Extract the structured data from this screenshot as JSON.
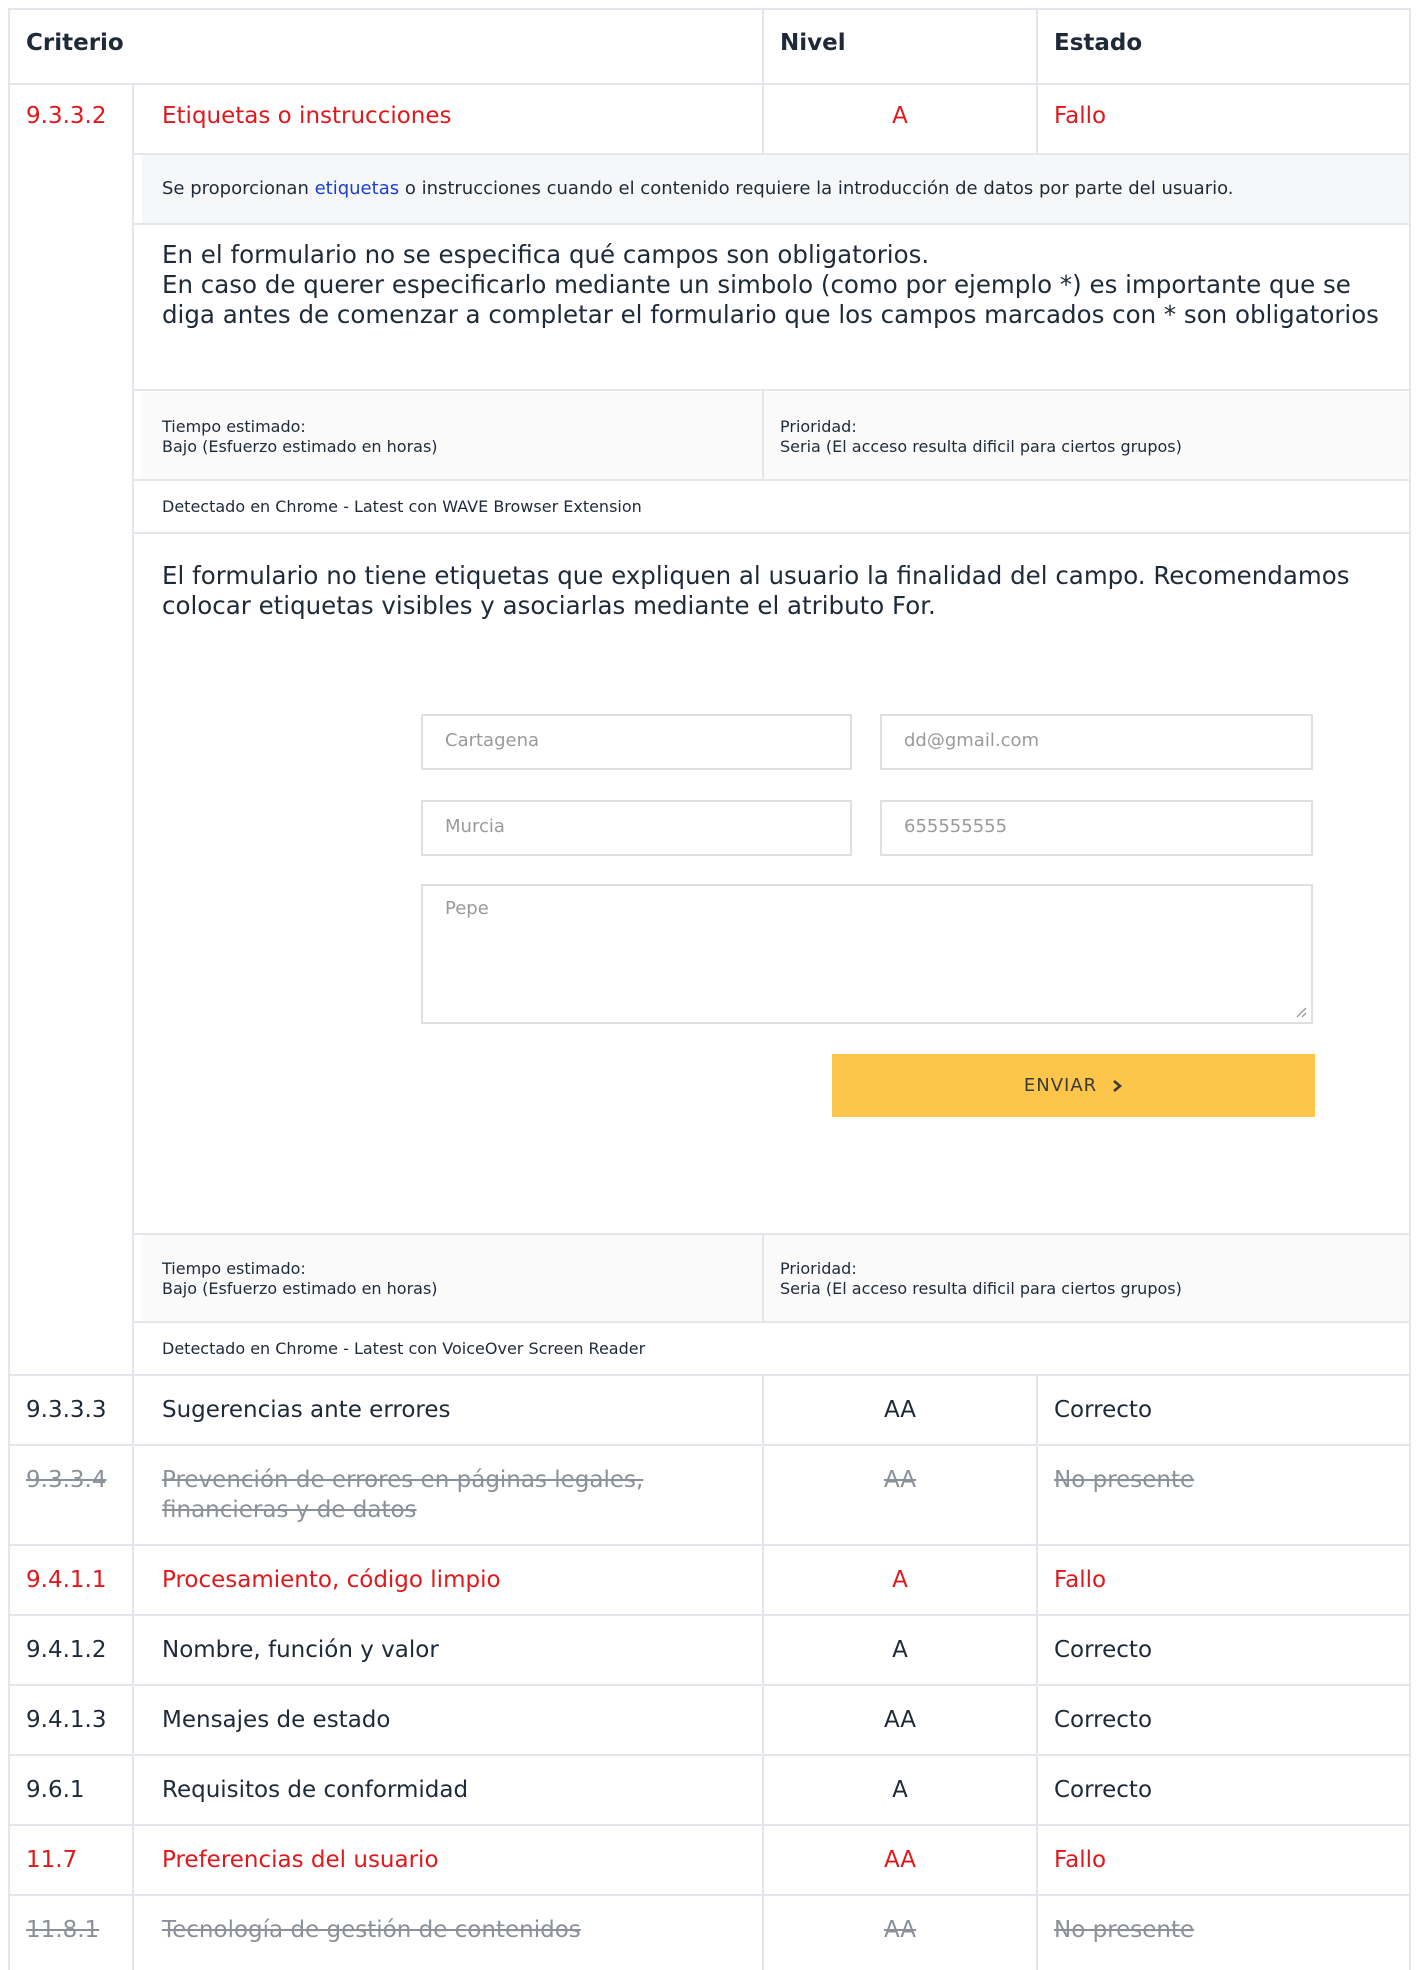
{
  "table": {
    "headers": {
      "criterio": "Criterio",
      "nivel": "Nivel",
      "estado": "Estado"
    },
    "expanded_row": {
      "code": "9.3.3.2",
      "name": "Etiquetas o instrucciones",
      "level": "A",
      "status": "Fallo",
      "description_pre": "Se proporcionan ",
      "description_link": "etiquetas",
      "description_post": " o instrucciones cuando el contenido requiere la introducción de datos por parte del usuario.",
      "issues": [
        {
          "text": "En el formulario no se especifica qué campos son obligatorios.\nEn caso de querer especificarlo mediante un simbolo (como por ejemplo *) es importante que se diga antes de comenzar a completar el formulario que los campos marcados con * son obligatorios",
          "time_label": "Tiempo estimado:",
          "time_value": "Bajo (Esfuerzo estimado en horas)",
          "priority_label": "Prioridad:",
          "priority_value": "Seria (El acceso resulta dificil para ciertos grupos)",
          "detected": "Detectado en Chrome - Latest con WAVE Browser Extension"
        },
        {
          "text": "El formulario no tiene etiquetas que expliquen al usuario la finalidad del campo. Recomendamos colocar etiquetas visibles y asociarlas mediante el atributo For.",
          "screenshot": {
            "fields": [
              "Cartagena",
              "dd@gmail.com",
              "Murcia",
              "655555555"
            ],
            "textarea": "Pepe",
            "button": "ENVIAR"
          },
          "time_label": "Tiempo estimado:",
          "time_value": "Bajo (Esfuerzo estimado en horas)",
          "priority_label": "Prioridad:",
          "priority_value": "Seria (El acceso resulta dificil para ciertos grupos)",
          "detected": "Detectado en Chrome - Latest con VoiceOver Screen Reader"
        }
      ]
    },
    "rows": [
      {
        "code": "9.3.3.3",
        "name": "Sugerencias ante errores",
        "level": "AA",
        "status": "Correcto"
      },
      {
        "code": "9.3.3.4",
        "name": "Prevención de errores en páginas legales,",
        "name2": "financieras y de datos",
        "level": "AA",
        "status": "No presente"
      },
      {
        "code": "9.4.1.1",
        "name": "Procesamiento, código limpio",
        "level": "A",
        "status": "Fallo"
      },
      {
        "code": "9.4.1.2",
        "name": "Nombre, función y valor",
        "level": "A",
        "status": "Correcto"
      },
      {
        "code": "9.4.1.3",
        "name": "Mensajes de estado",
        "level": "AA",
        "status": "Correcto"
      },
      {
        "code": "9.6.1",
        "name": "Requisitos de conformidad",
        "level": "A",
        "status": "Correcto"
      },
      {
        "code": "11.7",
        "name": "Preferencias del usuario",
        "level": "AA",
        "status": "Fallo"
      },
      {
        "code": "11.8.1",
        "name": "Tecnología de gestión de contenidos",
        "level": "AA",
        "status": "No presente"
      }
    ]
  },
  "colors": {
    "fail": "#e0181b",
    "not_present": "#8b9198",
    "text": "#1e2a38",
    "link": "#1a3fd0",
    "button": "#fdc64a"
  }
}
